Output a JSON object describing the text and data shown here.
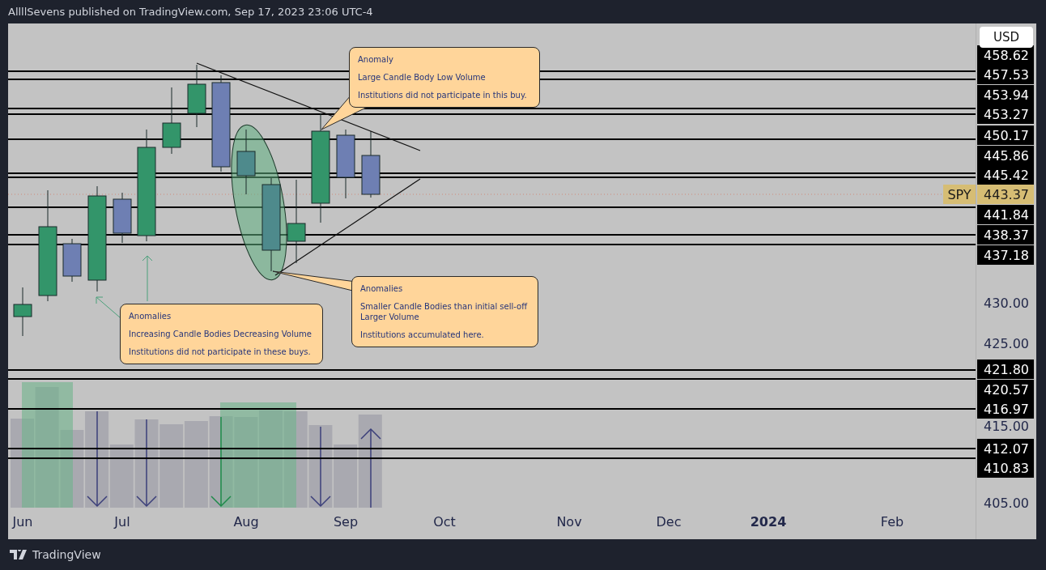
{
  "header": {
    "text": "AllllSevens published on TradingView.com, Sep 17, 2023 23:06 UTC-4"
  },
  "currency_button": {
    "label": "USD"
  },
  "symbol_label": {
    "text": "SPY"
  },
  "price_axis": [
    {
      "text": "458.62",
      "kind": "level"
    },
    {
      "text": "457.53",
      "kind": "level"
    },
    {
      "text": "453.94",
      "kind": "level"
    },
    {
      "text": "453.27",
      "kind": "level"
    },
    {
      "text": "450.17",
      "kind": "level"
    },
    {
      "text": "445.86",
      "kind": "level"
    },
    {
      "text": "445.42",
      "kind": "level"
    },
    {
      "text": "443.37",
      "kind": "last"
    },
    {
      "text": "441.84",
      "kind": "level"
    },
    {
      "text": "438.37",
      "kind": "level"
    },
    {
      "text": "437.18",
      "kind": "level"
    },
    {
      "text": "430.00",
      "kind": "tick"
    },
    {
      "text": "425.00",
      "kind": "tick"
    },
    {
      "text": "421.80",
      "kind": "level"
    },
    {
      "text": "420.57",
      "kind": "level"
    },
    {
      "text": "416.97",
      "kind": "level"
    },
    {
      "text": "415.00",
      "kind": "tick"
    },
    {
      "text": "412.07",
      "kind": "level"
    },
    {
      "text": "410.83",
      "kind": "level"
    },
    {
      "text": "405.00",
      "kind": "tick"
    }
  ],
  "time_axis": [
    {
      "text": "Jun",
      "kind": "month"
    },
    {
      "text": "Jul",
      "kind": "month"
    },
    {
      "text": "Aug",
      "kind": "month"
    },
    {
      "text": "Sep",
      "kind": "month"
    },
    {
      "text": "Oct",
      "kind": "month"
    },
    {
      "text": "Nov",
      "kind": "month"
    },
    {
      "text": "Dec",
      "kind": "month"
    },
    {
      "text": "2024",
      "kind": "year"
    },
    {
      "text": "Feb",
      "kind": "month"
    }
  ],
  "callouts": [
    {
      "paragraphs": [
        [
          "Anomaly"
        ],
        [
          "Large Candle Body Low Volume"
        ],
        [
          "Institutions did not participate in this buy."
        ]
      ]
    },
    {
      "paragraphs": [
        [
          "Anomalies"
        ],
        [
          "Smaller Candle Bodies than initial sell-off",
          "Larger Volume"
        ],
        [
          "Institutions accumulated here."
        ]
      ]
    },
    {
      "paragraphs": [
        [
          "Anomalies"
        ],
        [
          "Increasing Candle Bodies Decreasing Volume"
        ],
        [
          "Institutions did not participate in these buys."
        ]
      ]
    }
  ],
  "footer": {
    "brand": "TradingView"
  }
}
